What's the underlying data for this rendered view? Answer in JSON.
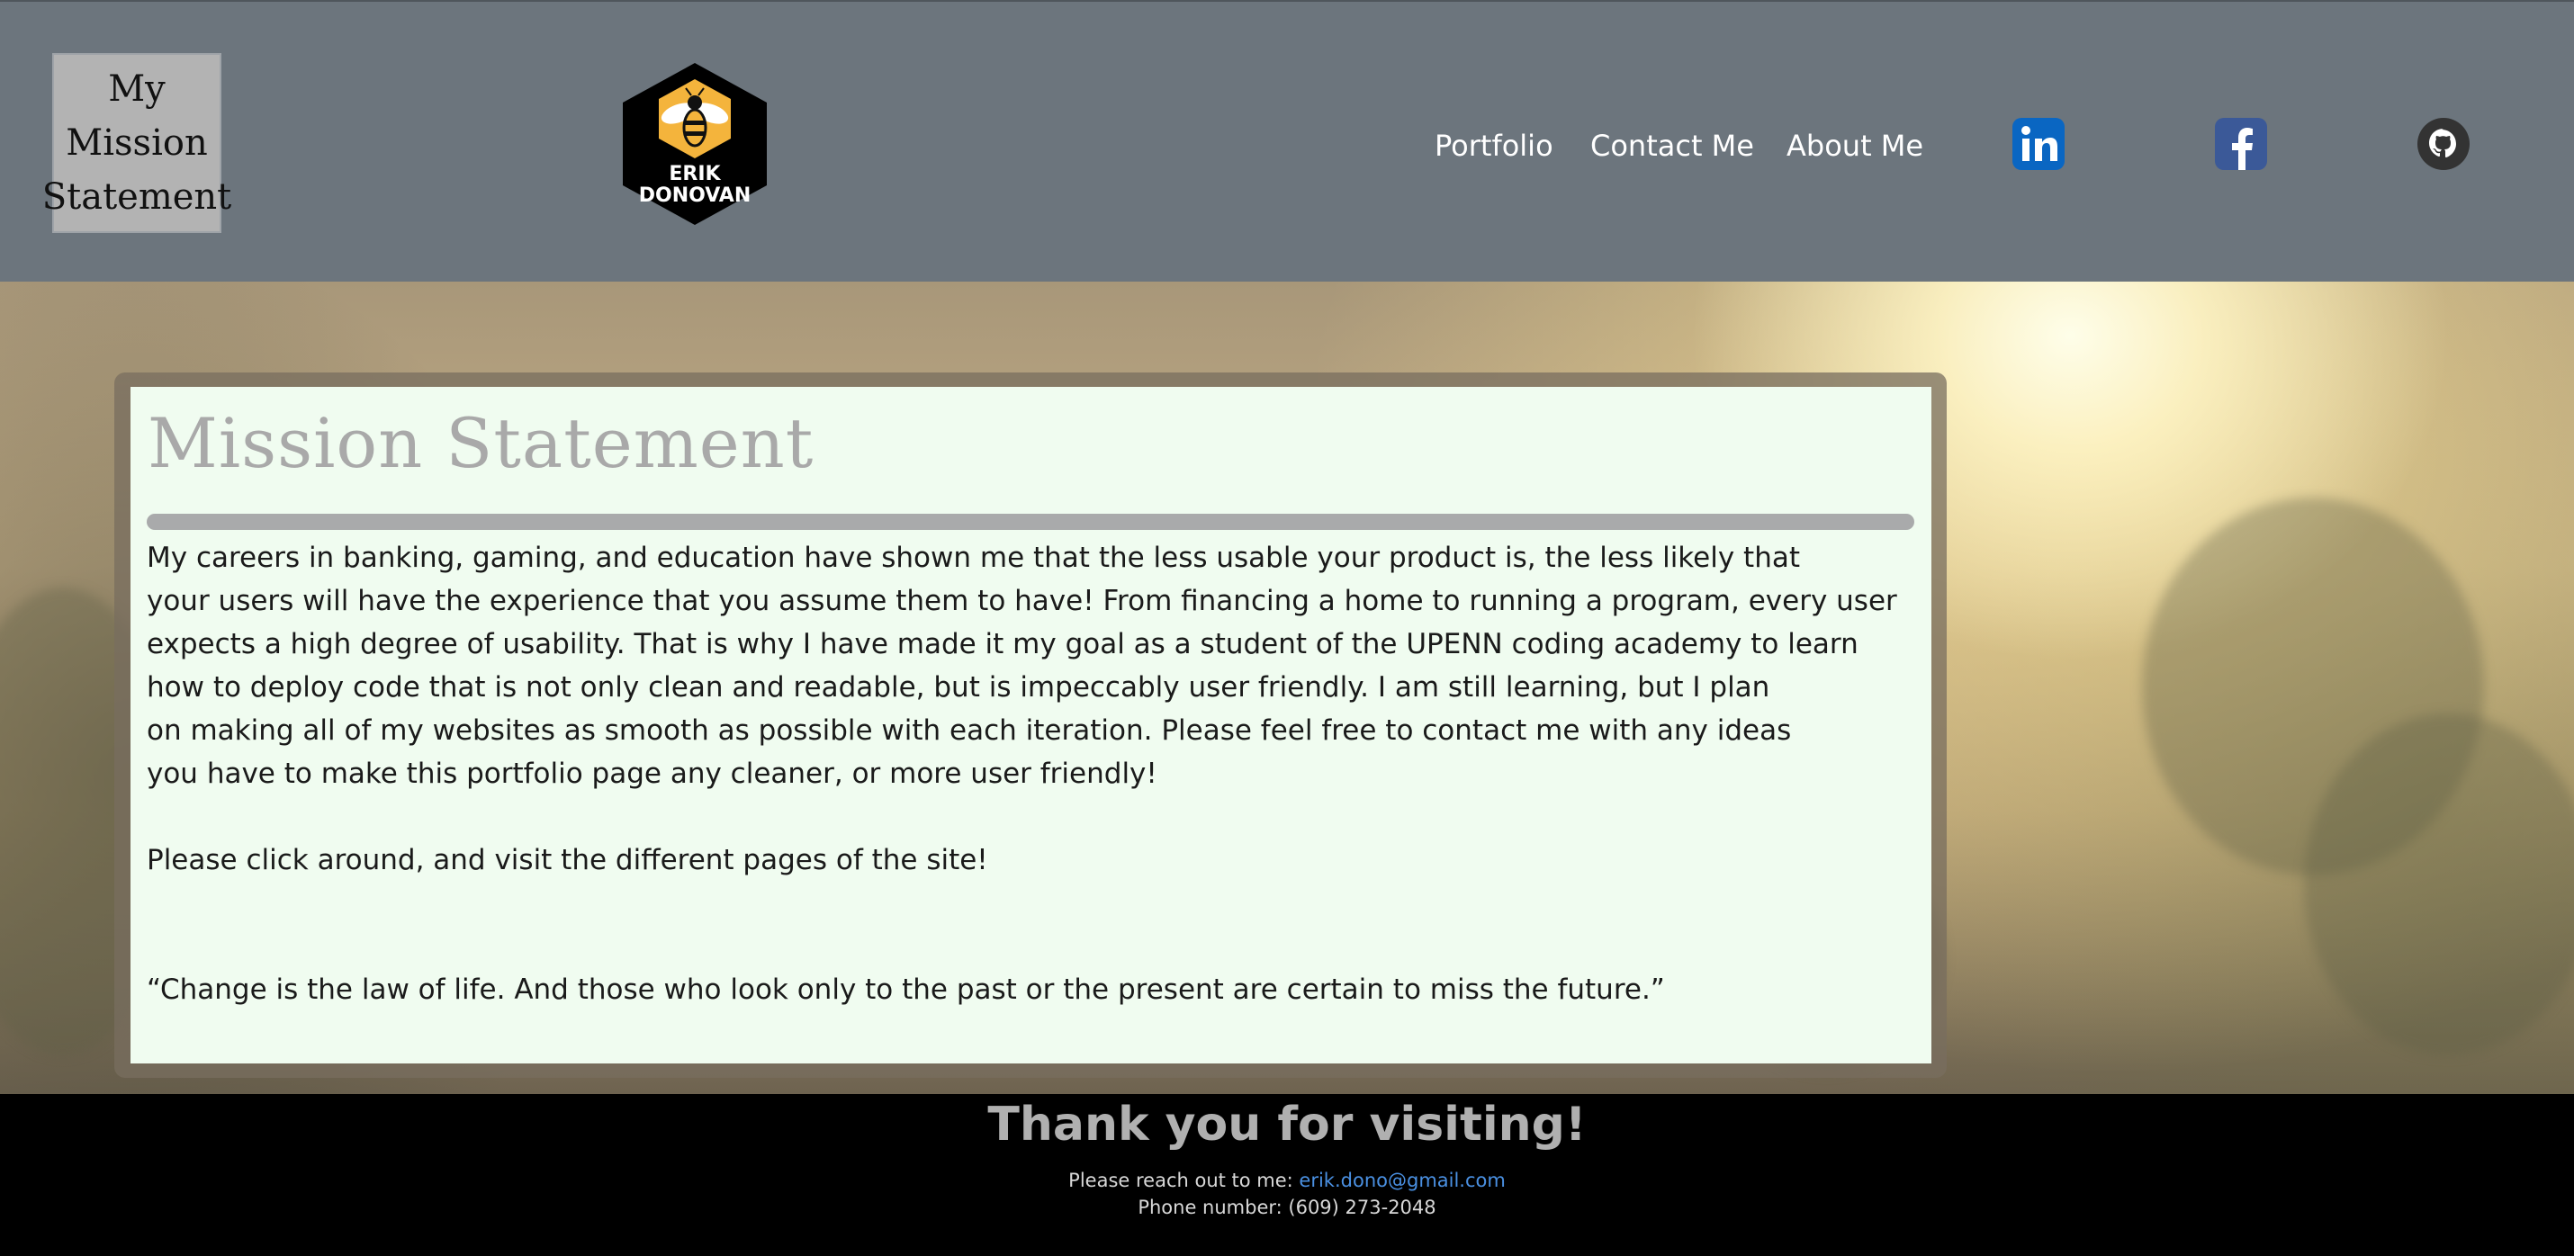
{
  "header": {
    "brand_lines": [
      "My",
      "Mission",
      "Statement"
    ],
    "logo": {
      "line1": "ERIK",
      "line2": "DONOVAN",
      "icon": "bee-icon"
    },
    "nav": [
      {
        "label": "Portfolio"
      },
      {
        "label": "Contact Me"
      },
      {
        "label": "About Me"
      }
    ],
    "social": [
      {
        "icon": "linkedin-icon",
        "text": "in",
        "color": "#0a66c2"
      },
      {
        "icon": "facebook-icon",
        "text": "f",
        "color": "#3b5998"
      },
      {
        "icon": "github-icon",
        "color": "#333333"
      }
    ],
    "background_color": "#6c757d"
  },
  "main": {
    "title": "Mission Statement",
    "paragraph_lines": [
      "My careers in banking, gaming, and education have shown me that the less usable your product is, the less likely that",
      "your users will have the experience that you assume them to have! From financing a home to running a program, every user",
      "expects a high degree of usability. That is why I have made it my goal as a student of the UPENN coding academy to learn",
      "how to deploy code that is not only clean and readable, but is impeccably user friendly. I am still learning, but I plan",
      "on making all of my websites as smooth as possible with each iteration. Please feel free to contact me with any ideas",
      "you have to make this portfolio page any cleaner, or more user friendly!"
    ],
    "paragraph2": "Please click around, and visit the different pages of the site!",
    "quote": "“Change is the law of life. And those who look only to the past or the present are certain to miss the future.”",
    "card_background": "#f0fcf0"
  },
  "footer": {
    "title": "Thank you for visiting!",
    "contact_prefix": "Please reach out to me: ",
    "email": "erik.dono@gmail.com",
    "phone_line": "Phone number: (609) 273-2048",
    "link_color": "#4a90e2"
  }
}
